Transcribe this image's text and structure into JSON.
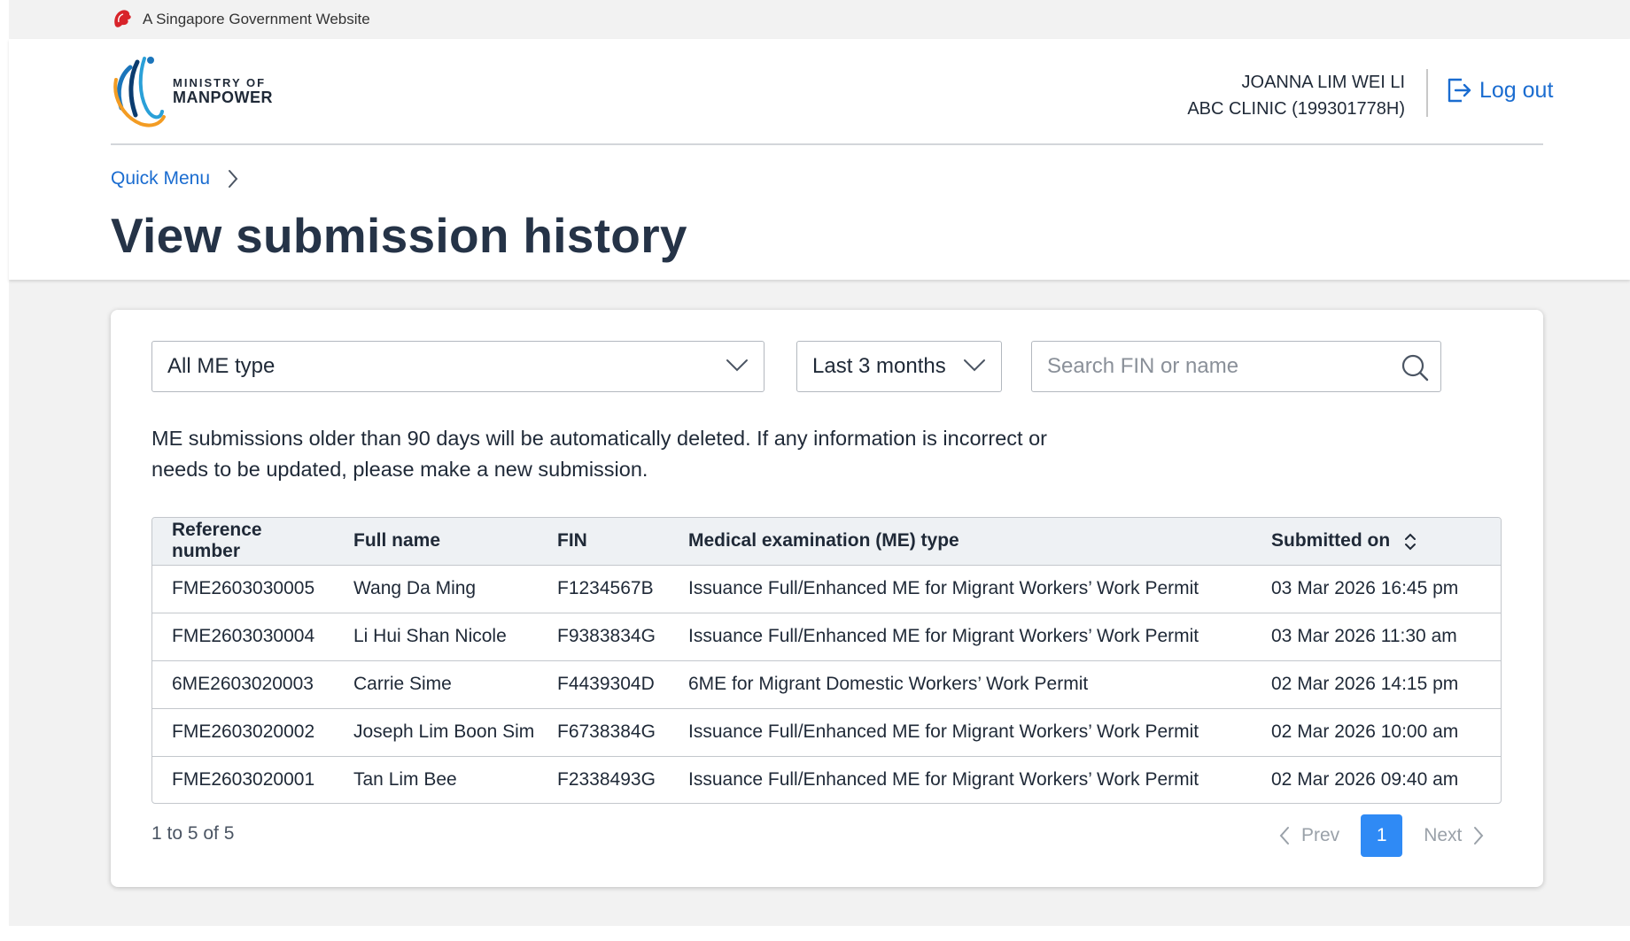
{
  "masthead": {
    "text": "A Singapore Government Website",
    "icon": "lion-head-icon"
  },
  "logo": {
    "line1": "MINISTRY OF",
    "line2": "MANPOWER"
  },
  "user": {
    "name": "JOANNA LIM WEI LI",
    "org": "ABC CLINIC (199301778H)"
  },
  "logout": {
    "label": "Log out",
    "icon": "logout-icon"
  },
  "breadcrumb": {
    "label": "Quick Menu"
  },
  "page_title": "View submission history",
  "filters": {
    "me_type": "All ME type",
    "period": "Last 3 months",
    "search_placeholder": "Search FIN or name"
  },
  "notice": "ME submissions older than 90 days will be automatically deleted. If any information is incorrect or needs to be updated, please make a new submission.",
  "table": {
    "headers": [
      "Reference number",
      "Full name",
      "FIN",
      "Medical examination (ME) type",
      "Submitted on"
    ],
    "rows": [
      [
        "FME2603030005",
        "Wang Da Ming",
        "F1234567B",
        "Issuance Full/Enhanced ME for Migrant Workers’ Work Permit",
        "03 Mar 2026 16:45 pm"
      ],
      [
        "FME2603030004",
        "Li Hui Shan Nicole",
        "F9383834G",
        "Issuance Full/Enhanced ME for Migrant Workers’ Work Permit",
        "03 Mar 2026 11:30 am"
      ],
      [
        "6ME2603020003",
        "Carrie Sime",
        "F4439304D",
        "6ME for Migrant Domestic Workers’ Work Permit",
        "02 Mar 2026 14:15 pm"
      ],
      [
        "FME2603020002",
        "Joseph Lim Boon Sim",
        "F6738384G",
        "Issuance Full/Enhanced ME for Migrant Workers’ Work Permit",
        "02 Mar 2026 10:00 am"
      ],
      [
        "FME2603020001",
        "Tan Lim Bee",
        "F2338493G",
        "Issuance Full/Enhanced ME for Migrant Workers’ Work Permit",
        "02 Mar 2026 09:40 am"
      ]
    ]
  },
  "pagination": {
    "range": "1 to 5 of 5",
    "prev": "Prev",
    "current": "1",
    "next": "Next"
  },
  "colors": {
    "link": "#1a6cd0",
    "active_page": "#2f8af5",
    "title": "#253347"
  }
}
